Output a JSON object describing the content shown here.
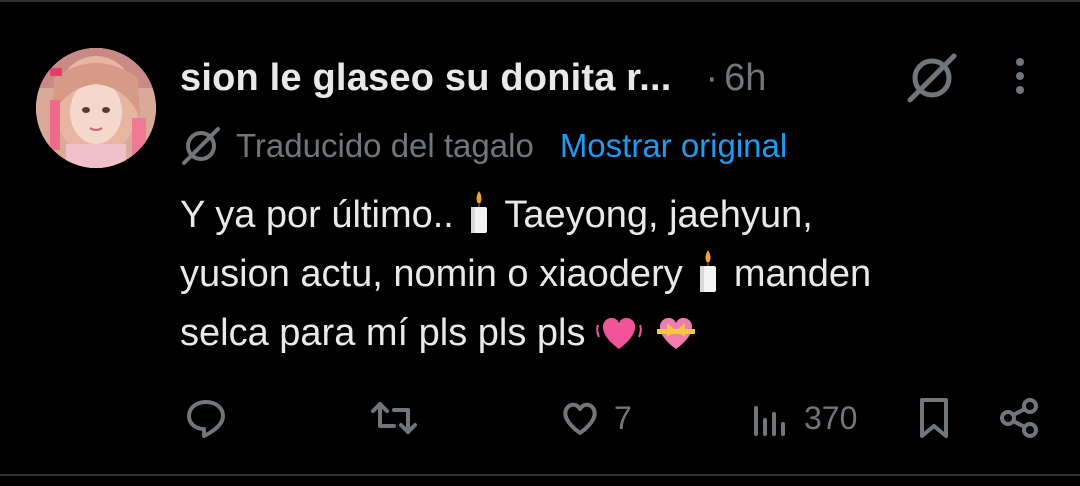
{
  "tweet": {
    "display_name": "sion le glaseo su donita r...",
    "separator": "·",
    "time": "6h",
    "translation": {
      "label": "Traducido del tagalo",
      "show_original": "Mostrar original"
    },
    "text": {
      "line1_part1": "Y ya por último..",
      "line1_part2": "Taeyong, jaehyun,",
      "line2_part1": "yusion actu, nomin o xiaodery",
      "line2_part2": "manden",
      "line3_part1": "selca para mí pls pls pls"
    },
    "emojis": [
      "candle-emoji",
      "candle-emoji",
      "beating-heart-emoji",
      "heart-with-ribbon-emoji"
    ],
    "actions": {
      "reply_icon": "reply-icon",
      "retweet_icon": "retweet-icon",
      "like_icon": "heart-icon",
      "like_count": "7",
      "views_icon": "views-icon",
      "view_count": "370",
      "bookmark_icon": "bookmark-icon",
      "share_icon": "share-icon"
    },
    "colors": {
      "background": "#000000",
      "text": "#e7e9ea",
      "muted": "#71767b",
      "link": "#1d9bf0",
      "divider": "#2f3336"
    }
  }
}
